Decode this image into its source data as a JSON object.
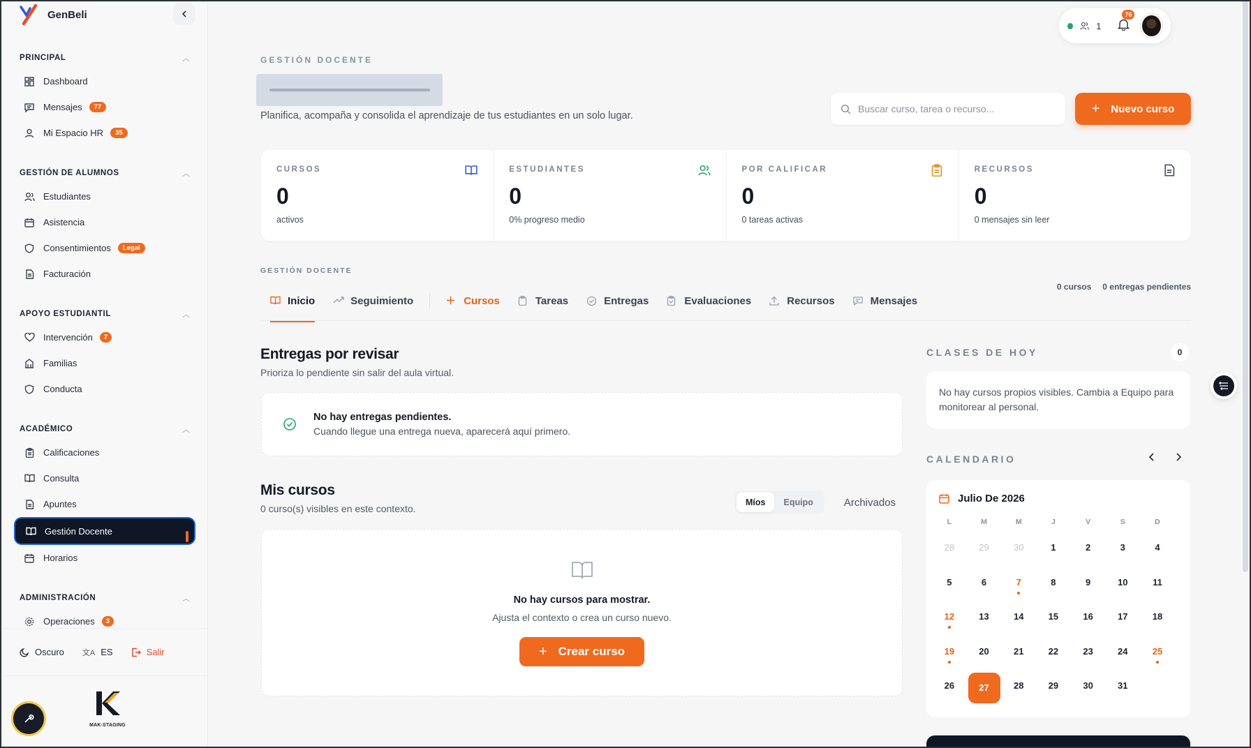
{
  "brand": {
    "name": "GenBeli"
  },
  "sidebar": {
    "sections": [
      {
        "title": "PRINCIPAL",
        "items": [
          {
            "label": "Dashboard",
            "icon": "dashboard-icon",
            "badge": ""
          },
          {
            "label": "Mensajes",
            "icon": "message-icon",
            "badge": "77"
          },
          {
            "label": "Mi Espacio HR",
            "icon": "user-icon",
            "badge": "35"
          }
        ]
      },
      {
        "title": "GESTIÓN DE ALUMNOS",
        "items": [
          {
            "label": "Estudiantes",
            "icon": "users-icon",
            "badge": ""
          },
          {
            "label": "Asistencia",
            "icon": "calendar-icon",
            "badge": ""
          },
          {
            "label": "Consentimientos",
            "icon": "shield-icon",
            "badge": "Legal"
          },
          {
            "label": "Facturación",
            "icon": "document-icon",
            "badge": ""
          }
        ]
      },
      {
        "title": "APOYO ESTUDIANTIL",
        "items": [
          {
            "label": "Intervención",
            "icon": "heart-icon",
            "badge": "7"
          },
          {
            "label": "Familias",
            "icon": "building-icon",
            "badge": ""
          },
          {
            "label": "Conducta",
            "icon": "shield-icon",
            "badge": ""
          }
        ]
      },
      {
        "title": "ACADÉMICO",
        "items": [
          {
            "label": "Calificaciones",
            "icon": "clipboard-icon",
            "badge": ""
          },
          {
            "label": "Consulta",
            "icon": "book-icon",
            "badge": ""
          },
          {
            "label": "Apuntes",
            "icon": "document-icon",
            "badge": ""
          },
          {
            "label": "Gestión Docente",
            "icon": "book-icon",
            "badge": ""
          },
          {
            "label": "Horarios",
            "icon": "calendar-icon",
            "badge": ""
          }
        ]
      },
      {
        "title": "ADMINISTRACIÓN",
        "items": [
          {
            "label": "Operaciones",
            "icon": "gear-icon",
            "badge": "3"
          }
        ]
      }
    ],
    "footer": {
      "theme": "Oscuro",
      "lang": "ES",
      "logout": "Salir"
    },
    "org_label": "MAK-STAGING"
  },
  "topbar": {
    "online_count": "1",
    "notif_count": "76"
  },
  "header": {
    "eyebrow": "GESTIÓN DOCENTE",
    "subtitle": "Planifica, acompaña y consolida el aprendizaje de tus estudiantes en un solo lugar.",
    "search_placeholder": "Buscar curso, tarea o recurso...",
    "new_button": "Nuevo curso"
  },
  "stats": [
    {
      "label": "CURSOS",
      "value": "0",
      "sub": "activos",
      "icon": "book-icon"
    },
    {
      "label": "ESTUDIANTES",
      "value": "0",
      "sub": "0% progreso medio",
      "icon": "users-icon"
    },
    {
      "label": "POR CALIFICAR",
      "value": "0",
      "sub": "0 tareas activas",
      "icon": "clipboard-icon"
    },
    {
      "label": "RECURSOS",
      "value": "0",
      "sub": "0 mensajes sin leer",
      "icon": "document-icon"
    }
  ],
  "tabs_eyebrow": "GESTIÓN DOCENTE",
  "tabs": [
    "Inicio",
    "Seguimiento",
    "Cursos",
    "Tareas",
    "Entregas",
    "Evaluaciones",
    "Recursos",
    "Mensajes"
  ],
  "tabs_meta": {
    "courses": "0 cursos",
    "pending": "0 entregas pendientes"
  },
  "entregas": {
    "title": "Entregas por revisar",
    "subtitle": "Prioriza lo pendiente sin salir del aula virtual.",
    "empty_title": "No hay entregas pendientes.",
    "empty_sub": "Cuando llegue una entrega nueva, aparecerá aquí primero."
  },
  "mis_cursos": {
    "title": "Mis cursos",
    "subtitle": "0 curso(s) visibles en este contexto.",
    "seg": [
      "Míos",
      "Equipo"
    ],
    "archived": "Archivados",
    "empty_title": "No hay cursos para mostrar.",
    "empty_sub": "Ajusta el contexto o crea un curso nuevo.",
    "create_button": "Crear curso"
  },
  "today": {
    "title": "CLASES DE HOY",
    "count": "0",
    "text": "No hay cursos propios visibles. Cambia a Equipo para monitorear al personal."
  },
  "calendar": {
    "title": "CALENDARIO",
    "month": "Julio De 2026",
    "dow": [
      "L",
      "M",
      "M",
      "J",
      "V",
      "S",
      "D"
    ],
    "days": [
      "28",
      "29",
      "30",
      "1",
      "2",
      "3",
      "4",
      "5",
      "6",
      "7",
      "8",
      "9",
      "10",
      "11",
      "12",
      "13",
      "14",
      "15",
      "16",
      "17",
      "18",
      "19",
      "20",
      "21",
      "22",
      "23",
      "24",
      "25",
      "26",
      "27",
      "28",
      "29",
      "30",
      "31",
      ""
    ]
  },
  "colors": {
    "accent": "#ef6a1f",
    "dark": "#0f1626",
    "success": "#22a66e"
  }
}
